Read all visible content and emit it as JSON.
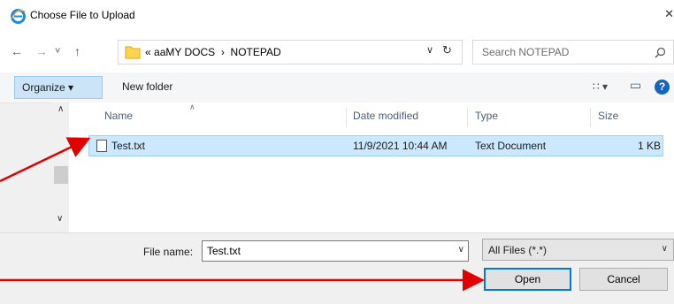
{
  "window": {
    "title": "Choose File to Upload",
    "close_glyph": "✕"
  },
  "nav": {
    "back": "←",
    "forward": "→",
    "recent": "˅",
    "up": "↑"
  },
  "address": {
    "prefix": "«",
    "crumbs": [
      "aaMY DOCS",
      "NOTEPAD"
    ],
    "separator": "›",
    "dropdown_glyph": "∨",
    "refresh_glyph": "↻"
  },
  "search": {
    "placeholder": "Search NOTEPAD",
    "icon": "search-icon"
  },
  "toolbar": {
    "organize_label": "Organize ▾",
    "new_folder_label": "New folder",
    "view_glyph": "∷ ▾",
    "preview_glyph": "▭",
    "help_glyph": "?"
  },
  "columns": {
    "name": "Name",
    "date": "Date modified",
    "type": "Type",
    "size": "Size"
  },
  "files": [
    {
      "name": "Test.txt",
      "date": "11/9/2021 10:44 AM",
      "type": "Text Document",
      "size": "1 KB"
    }
  ],
  "bottom": {
    "filename_label": "File name:",
    "filename_value": "Test.txt",
    "filter_label": "All Files (*.*)",
    "open_label": "Open",
    "cancel_label": "Cancel"
  },
  "colors": {
    "annotation_arrow": "#e00000",
    "selection": "#cce8ff",
    "focus": "#0078d7"
  }
}
